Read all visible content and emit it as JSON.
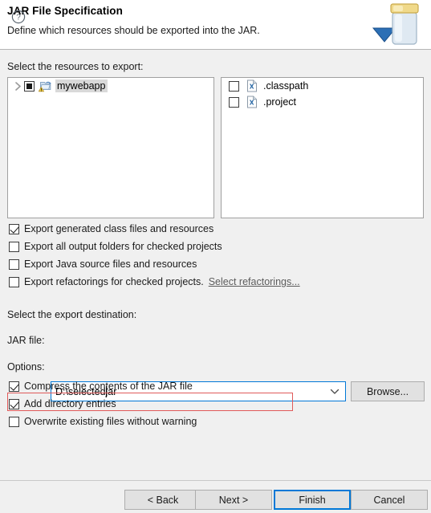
{
  "header": {
    "title": "JAR File Specification",
    "description": "Define which resources should be exported into the JAR.",
    "icon": "jar-export-icon"
  },
  "resources": {
    "section_label": "Select the resources to export:",
    "tree": {
      "items": [
        {
          "label": "mywebapp",
          "checkbox_state": "grayed",
          "expanded": false,
          "selected": true,
          "icon": "project-folder-warning-icon"
        }
      ]
    },
    "files": {
      "items": [
        {
          "label": ".classpath",
          "checkbox_state": "unchecked",
          "icon": "xml-file-icon"
        },
        {
          "label": ".project",
          "checkbox_state": "unchecked",
          "icon": "xml-file-icon"
        }
      ]
    }
  },
  "export_options": [
    {
      "label": "Export generated class files and resources",
      "checkbox_state": "checked"
    },
    {
      "label": "Export all output folders for checked projects",
      "checkbox_state": "unchecked"
    },
    {
      "label": "Export Java source files and resources",
      "checkbox_state": "unchecked"
    },
    {
      "label": "Export refactorings for checked projects.",
      "checkbox_state": "unchecked",
      "link": "Select refactorings..."
    }
  ],
  "destination": {
    "section_label": "Select the export destination:",
    "field_label": "JAR file:",
    "value": "D:\\selected.jar",
    "value_before_caret": "D:\\selected",
    "value_after_caret": "jar",
    "placeholder": "",
    "browse_label": "Browse...",
    "dropdown_icon": "chevron-down-icon"
  },
  "options": {
    "section_label": "Options:",
    "items": [
      {
        "label": "Compress the contents of the JAR file",
        "checkbox_state": "checked",
        "highlighted": false
      },
      {
        "label": "Add directory entries",
        "checkbox_state": "checked",
        "highlighted": true
      },
      {
        "label": "Overwrite existing files without warning",
        "checkbox_state": "unchecked",
        "highlighted": false
      }
    ]
  },
  "footer": {
    "help_icon": "help-circle-icon",
    "buttons": [
      {
        "label": "< Back",
        "focused": false
      },
      {
        "label": "Next >",
        "focused": false
      },
      {
        "label": "Finish",
        "focused": true
      },
      {
        "label": "Cancel",
        "focused": false
      }
    ]
  },
  "colors": {
    "focus_blue": "#0078D7",
    "annotation_red": "#E05A5A",
    "dialog_bg": "#F0F0F0",
    "panel_bg": "#FFFFFF"
  }
}
